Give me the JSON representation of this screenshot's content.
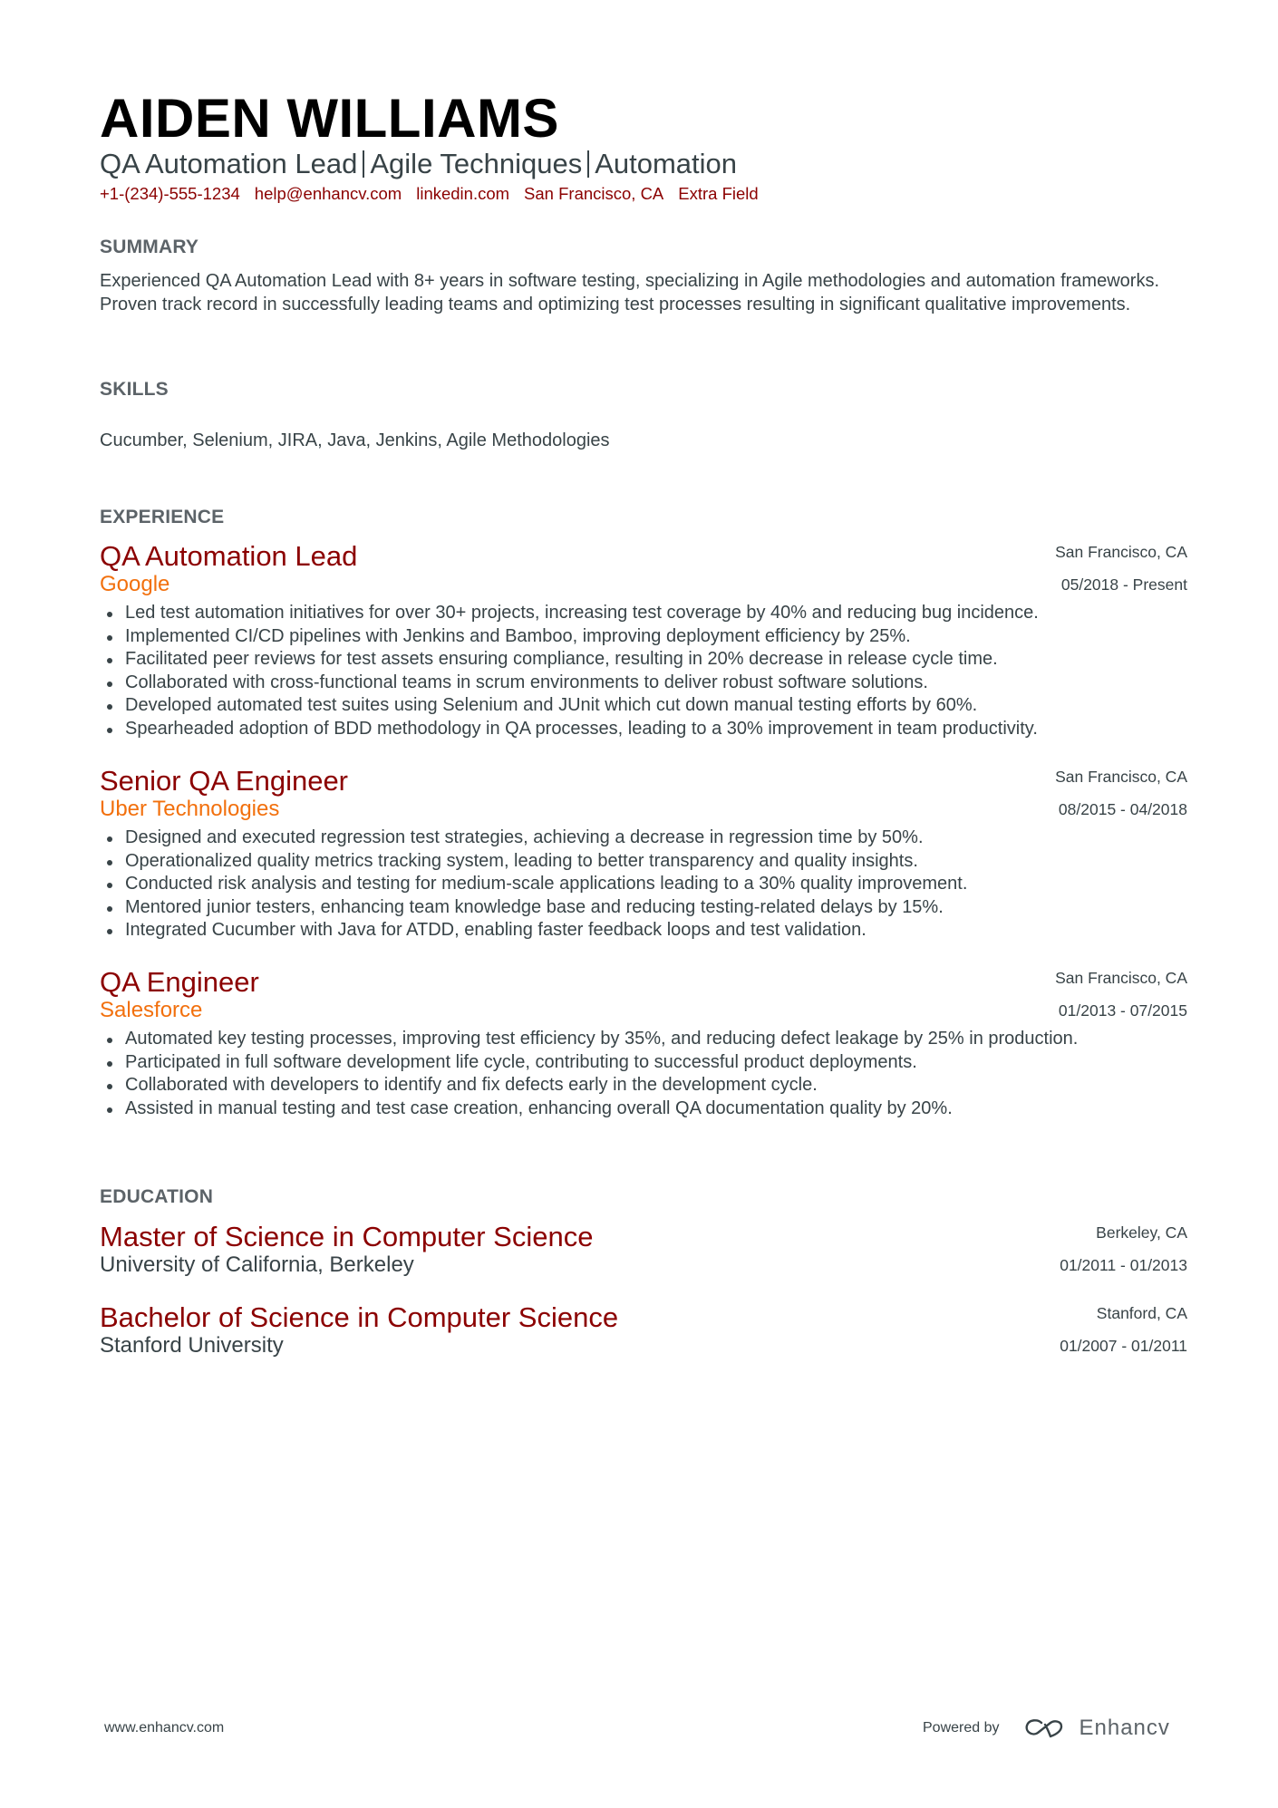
{
  "header": {
    "name": "AIDEN WILLIAMS",
    "subtitle_parts": [
      "QA Automation Lead",
      "Agile Techniques",
      "Automation"
    ],
    "contacts": [
      "+1-(234)-555-1234",
      "help@enhancv.com",
      "linkedin.com",
      "San Francisco, CA",
      "Extra Field"
    ]
  },
  "summary": {
    "heading": "SUMMARY",
    "text": "Experienced QA Automation Lead with 8+ years in software testing, specializing in Agile methodologies and automation frameworks. Proven track record in successfully leading teams and optimizing test processes resulting in significant qualitative improvements."
  },
  "skills": {
    "heading": "SKILLS",
    "text": "Cucumber, Selenium, JIRA, Java, Jenkins, Agile Methodologies"
  },
  "experience": {
    "heading": "EXPERIENCE",
    "jobs": [
      {
        "title": "QA Automation Lead",
        "company": "Google",
        "location": "San Francisco, CA",
        "dates": "05/2018 - Present",
        "bullets": [
          "Led test automation initiatives for over 30+ projects, increasing test coverage by 40% and reducing bug incidence.",
          "Implemented CI/CD pipelines with Jenkins and Bamboo, improving deployment efficiency by 25%.",
          "Facilitated peer reviews for test assets ensuring compliance, resulting in 20% decrease in release cycle time.",
          "Collaborated with cross-functional teams in scrum environments to deliver robust software solutions.",
          "Developed automated test suites using Selenium and JUnit which cut down manual testing efforts by 60%.",
          "Spearheaded adoption of BDD methodology in QA processes, leading to a 30% improvement in team productivity."
        ]
      },
      {
        "title": "Senior QA Engineer",
        "company": "Uber Technologies",
        "location": "San Francisco, CA",
        "dates": "08/2015 - 04/2018",
        "bullets": [
          "Designed and executed regression test strategies, achieving a decrease in regression time by 50%.",
          "Operationalized quality metrics tracking system, leading to better transparency and quality insights.",
          "Conducted risk analysis and testing for medium-scale applications leading to a 30% quality improvement.",
          "Mentored junior testers, enhancing team knowledge base and reducing testing-related delays by 15%.",
          "Integrated Cucumber with Java for ATDD, enabling faster feedback loops and test validation."
        ]
      },
      {
        "title": "QA Engineer",
        "company": "Salesforce",
        "location": "San Francisco, CA",
        "dates": "01/2013 - 07/2015",
        "bullets": [
          "Automated key testing processes, improving test efficiency by 35%, and reducing defect leakage by 25% in production.",
          "Participated in full software development life cycle, contributing to successful product deployments.",
          "Collaborated with developers to identify and fix defects early in the development cycle.",
          "Assisted in manual testing and test case creation, enhancing overall QA documentation quality by 20%."
        ]
      }
    ]
  },
  "education": {
    "heading": "EDUCATION",
    "items": [
      {
        "degree": "Master of Science in Computer Science",
        "school": "University of California, Berkeley",
        "location": "Berkeley, CA",
        "dates": "01/2011 - 01/2013"
      },
      {
        "degree": "Bachelor of Science in Computer Science",
        "school": "Stanford University",
        "location": "Stanford, CA",
        "dates": "01/2007 - 01/2011"
      }
    ]
  },
  "footer": {
    "website": "www.enhancv.com",
    "powered_by": "Powered by",
    "brand": "Enhancv",
    "brand_icon": "enhancv-logo-icon"
  },
  "colors": {
    "accent_title": "#8b0000",
    "accent_company": "#f2700d",
    "heading_grey": "#5c6368",
    "body_text": "#384347"
  }
}
